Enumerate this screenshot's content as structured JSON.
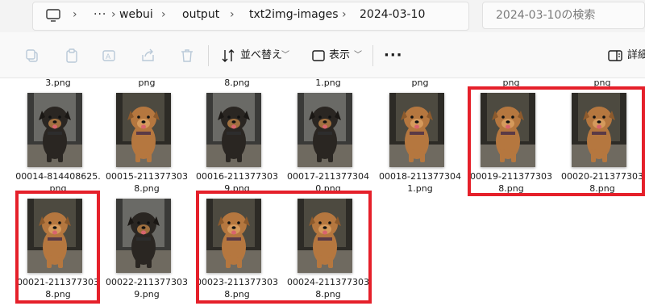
{
  "address": {
    "crumbs": [
      "webui",
      "output",
      "txt2img-images",
      "2024-03-10"
    ],
    "search_placeholder": "2024-03-10の検索"
  },
  "toolbar": {
    "sort_label": "並べ替え",
    "view_label": "表示",
    "details_label": "詳細"
  },
  "top_row_names": [
    "3.png",
    "png",
    "8.png",
    "1.png",
    "png",
    "png",
    "png"
  ],
  "files": [
    {
      "name_line1": "00014-814408625.",
      "name_line2": "png",
      "fur": "black"
    },
    {
      "name_line1": "00015-211377303",
      "name_line2": "8.png",
      "fur": "brown"
    },
    {
      "name_line1": "00016-211377303",
      "name_line2": "9.png",
      "fur": "black"
    },
    {
      "name_line1": "00017-211377304",
      "name_line2": "0.png",
      "fur": "black"
    },
    {
      "name_line1": "00018-211377304",
      "name_line2": "1.png",
      "fur": "brown"
    },
    {
      "name_line1": "00019-211377303",
      "name_line2": "8.png",
      "fur": "brown"
    },
    {
      "name_line1": "00020-211377303",
      "name_line2": "8.png",
      "fur": "brown"
    },
    {
      "name_line1": "00021-211377303",
      "name_line2": "8.png",
      "fur": "brown"
    },
    {
      "name_line1": "00022-211377303",
      "name_line2": "9.png",
      "fur": "black"
    },
    {
      "name_line1": "00023-211377303",
      "name_line2": "8.png",
      "fur": "brown"
    },
    {
      "name_line1": "00024-211377303",
      "name_line2": "8.png",
      "fur": "brown"
    }
  ],
  "colors": {
    "highlight": "#e5202a",
    "brown_dog": "#b5773f",
    "black_dog": "#2a2622"
  },
  "icons": [
    "monitor-icon",
    "more-icon",
    "copy-icon",
    "paste-icon",
    "rename-icon",
    "share-icon",
    "delete-icon",
    "sort-icon",
    "view-icon",
    "more-options-icon",
    "details-pane-icon"
  ]
}
